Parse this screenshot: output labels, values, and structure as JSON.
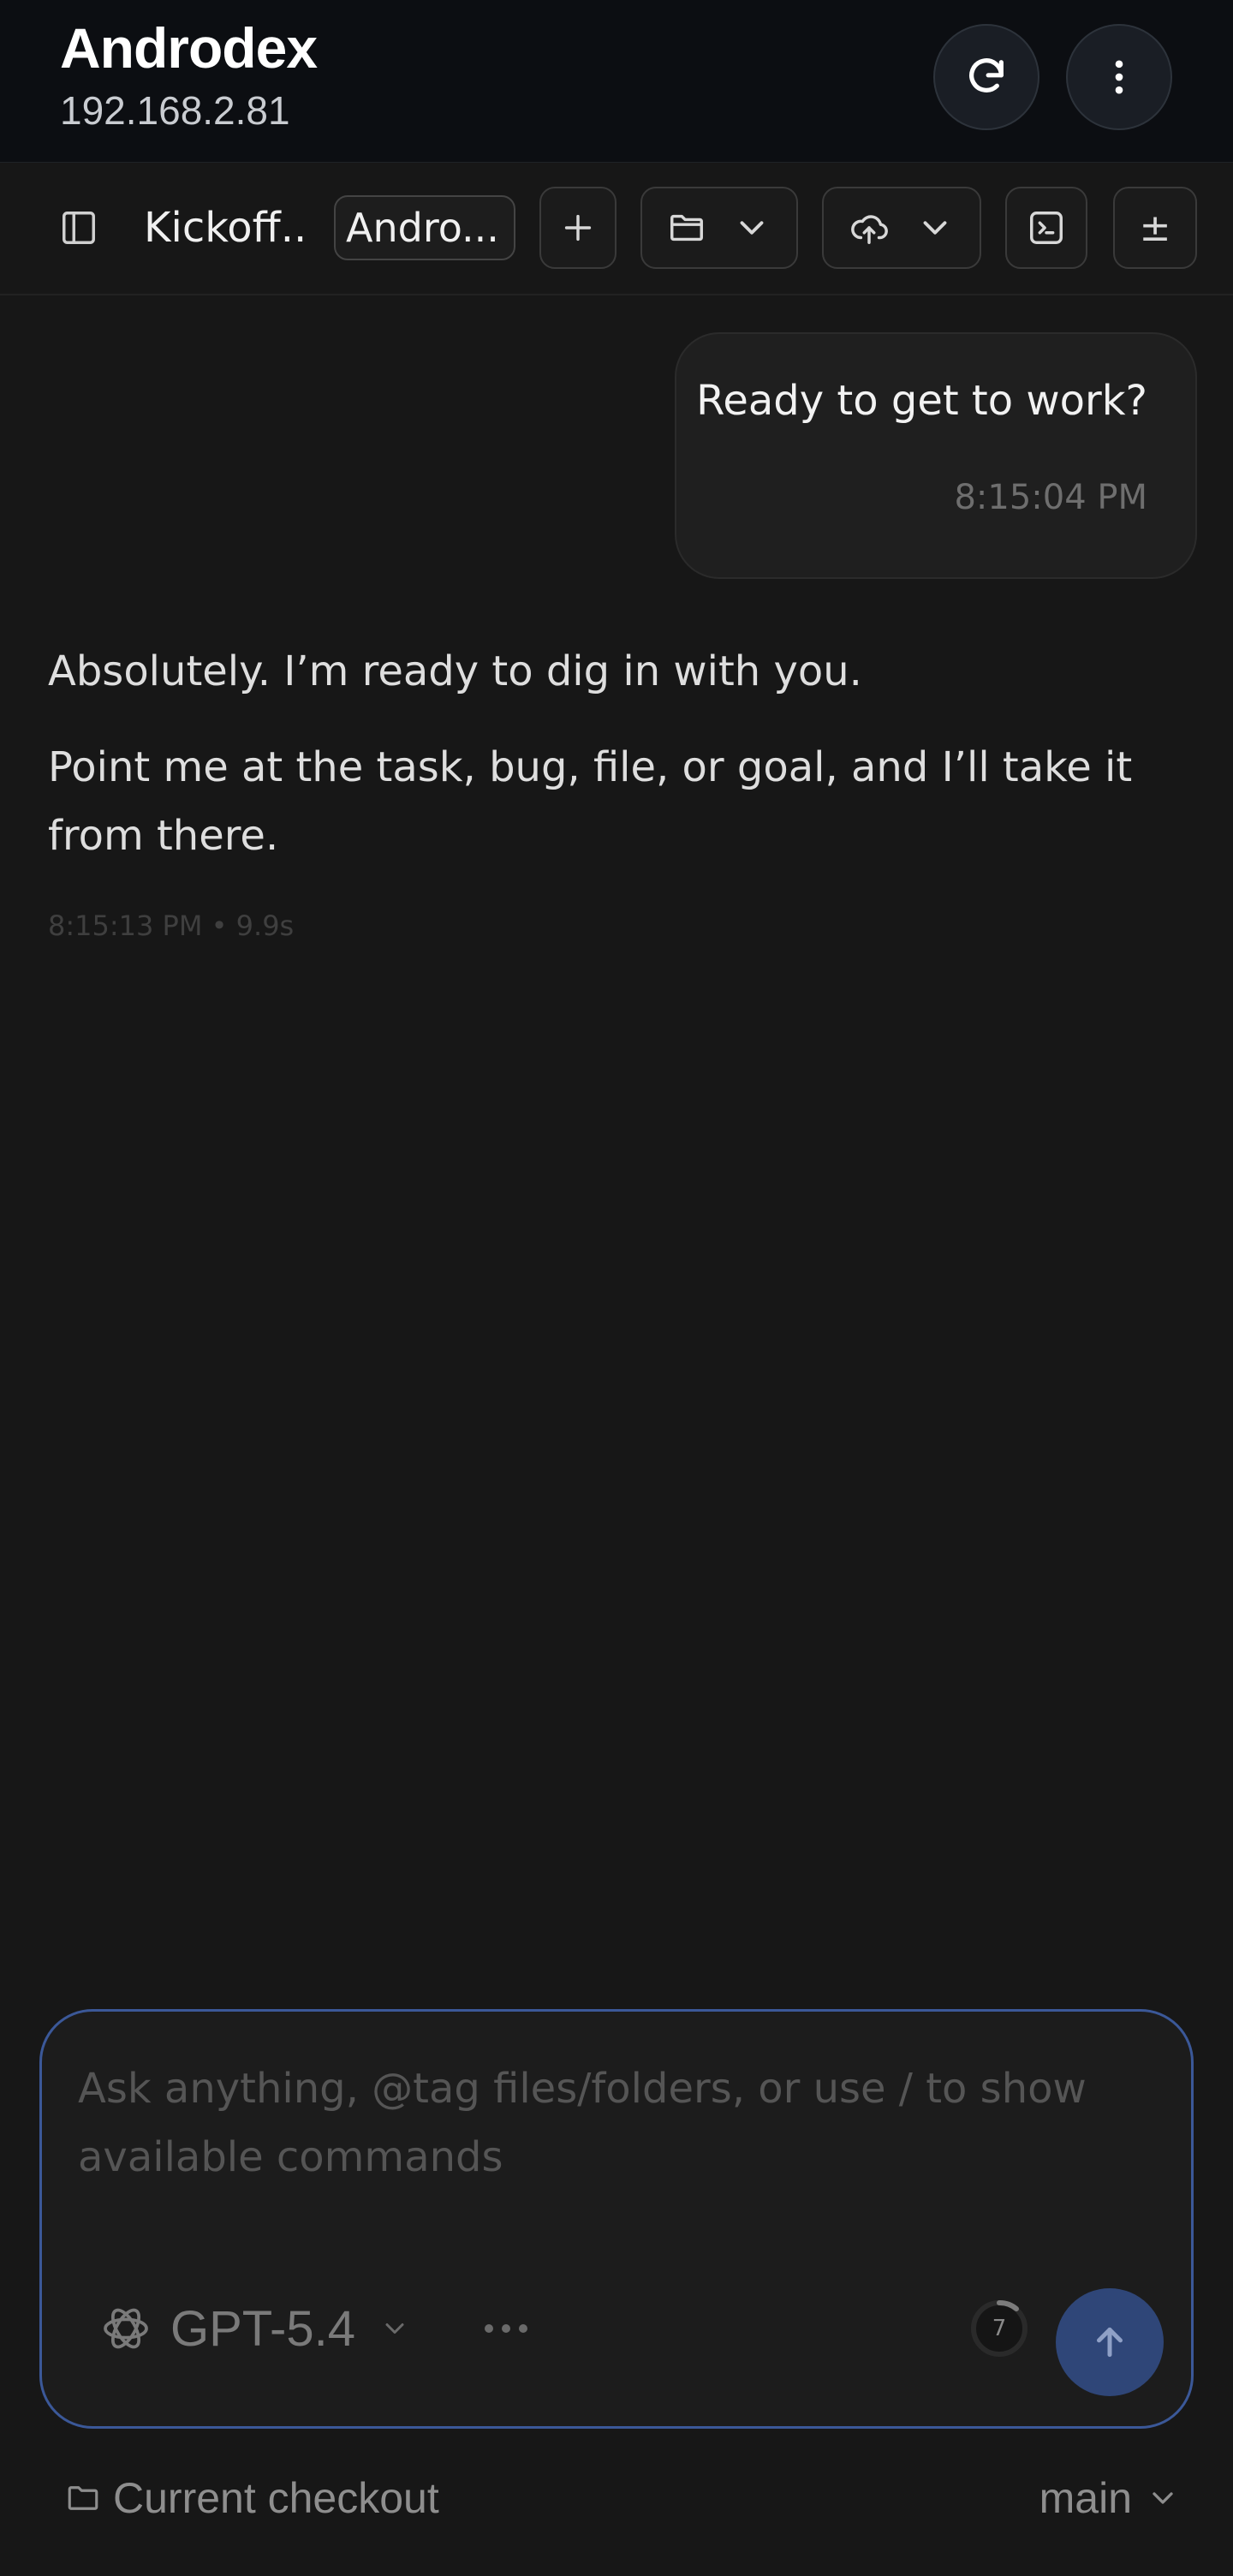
{
  "header": {
    "title": "Androdex",
    "subtitle": "192.168.2.81",
    "refresh_icon": "refresh-icon",
    "more_icon": "more-vertical-icon"
  },
  "toolbar": {
    "thread_title": "Kickoff...",
    "workspace": "Andro...",
    "diff_label": "±"
  },
  "messages": {
    "user": {
      "text": "Ready to get to work?",
      "time": "8:15:04 PM"
    },
    "assistant": {
      "paragraph1": "Absolutely. I’m ready to dig in with you.",
      "paragraph2": "Point me at the task, bug, file, or goal, and I’ll take it from there.",
      "meta": "8:15:13 PM • 9.9s"
    }
  },
  "composer": {
    "placeholder": "Ask anything, @tag files/folders, or use / to show available commands",
    "model": "GPT-5.4",
    "context_count": "7",
    "accent": "#3b5898",
    "send_color": "#2f4678"
  },
  "footer": {
    "checkout": "Current checkout",
    "branch": "main"
  }
}
